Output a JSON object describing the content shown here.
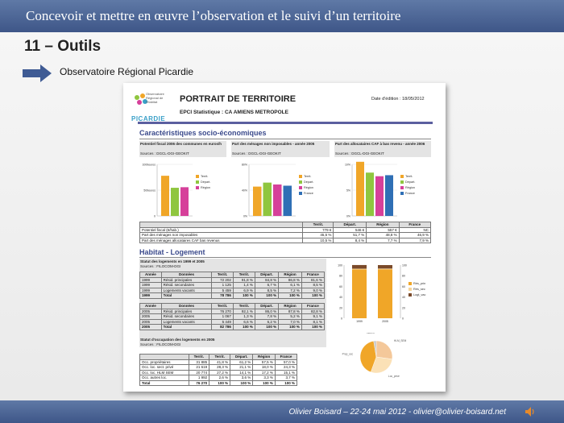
{
  "header": {
    "title": "Concevoir et mettre en œuvre l’observation et le suivi d’un territoire"
  },
  "section": {
    "title": "11 – Outils",
    "subtitle": "Observatoire Régional Picardie"
  },
  "footer": {
    "text": "Olivier Boisard – 22-24 mai 2012 - olivier@olivier-boisard.net"
  },
  "document": {
    "logo_word": "PICARDIE",
    "logo_sub": "Observatoire Régional de l'Habitat",
    "title": "PORTRAIT DE TERRITOIRE",
    "subtitle": "EPCI Statistique : CA AMIENS METROPOLE",
    "date": "Date d'édition : 18/05/2012",
    "socio": {
      "heading": "Caractéristiques socio-économiques",
      "blocks": [
        {
          "title": "Potentiel fiscal 2006 des communes en euros/h",
          "source": "Sources : DGCL-DGI-GEOKIT"
        },
        {
          "title": "Part des ménages non imposables - année 2005",
          "source": "Sources : DGCL-DGI-GEOKIT"
        },
        {
          "title": "Part des allocataires CAF à bas revenu - année 2006",
          "source": "Sources : DGCL-DGI-GEOKIT"
        }
      ],
      "table": {
        "headers": [
          "",
          "Territ.",
          "Départ.",
          "Région",
          "France"
        ],
        "rows": [
          [
            "Potentiel fiscal (€/hab.)",
            "779 €",
            "546 €",
            "557 €",
            "NC"
          ],
          [
            "Part des ménages non imposables",
            "45,5 %",
            "51,7 %",
            "48,8 %",
            "46,9 %"
          ],
          [
            "Part des ménages allocataires CAF bas revenus",
            "10,5 %",
            "8,4 %",
            "7,7 %",
            "7,9 %"
          ]
        ]
      }
    },
    "habitat": {
      "heading": "Habitat - Logement",
      "block_title": "Statut des logements en 1999 et 2005",
      "source": "Sources : FILOCOM-DGI",
      "headers": [
        "Année",
        "Données",
        "Territ.",
        "Territ.",
        "Départ.",
        "Région",
        "France"
      ],
      "rows_1999": [
        [
          "1999",
          "Résid. principales",
          "72 202",
          "91,8 %",
          "84,8 %",
          "86,8 %",
          "81,6 %"
        ],
        [
          "1999",
          "Résid. secondaires",
          "1 125",
          "1,4 %",
          "6,7 %",
          "6,1 %",
          "8,5 %"
        ],
        [
          "1999",
          "Logements vacants",
          "5 459",
          "6,9 %",
          "8,5 %",
          "7,2 %",
          "9,0 %"
        ],
        [
          "1999",
          "Total",
          "78 786",
          "100 %",
          "100 %",
          "100 %",
          "100 %"
        ]
      ],
      "rows_2005": [
        [
          "2005",
          "Résid. principales",
          "76 270",
          "92,1 %",
          "86,0 %",
          "87,8 %",
          "82,8 %"
        ],
        [
          "2005",
          "Résid. secondaires",
          "1 067",
          "1,3 %",
          "7,8 %",
          "5,2 %",
          "9,1 %"
        ],
        [
          "2005",
          "Logements vacants",
          "5 449",
          "6,6 %",
          "6,2 %",
          "7,0 %",
          "8,1 %"
        ],
        [
          "2005",
          "Total",
          "82 786",
          "100 %",
          "100 %",
          "100 %",
          "100 %"
        ]
      ],
      "occupation_title": "Statut d'occupation des logements en 2005",
      "occupation_source": "Sources : FILOCOM-DGI",
      "occupation_headers": [
        "",
        "Territ.",
        "Territ.",
        "Départ.",
        "Région",
        "France"
      ],
      "occupation_rows": [
        [
          "Occ. propriétaires",
          "31 885",
          "41,8 %",
          "61,2 %",
          "57,5 %",
          "57,0 %"
        ],
        [
          "Occ. loc. sect. privé",
          "21 619",
          "28,3 %",
          "21,1 %",
          "18,0 %",
          "24,3 %"
        ],
        [
          "Occ. loc. HLM SEM",
          "20 774",
          "27,2 %",
          "14,1 %",
          "17,2 %",
          "15,1 %"
        ],
        [
          "Occ. autres loc.",
          "1 992",
          "2,6 %",
          "3,6 %",
          "3,3 %",
          "3,7 %"
        ],
        [
          "Total",
          "76 270",
          "100 %",
          "100 %",
          "100 %",
          "100 %"
        ]
      ],
      "stack_legend": [
        "Rés_prin",
        "Rés_sec",
        "Logt_vac"
      ],
      "stack_years": [
        "1999",
        "2005"
      ],
      "pie_labels": [
        "HLM_SEM",
        "Loc_privé",
        "Prop_occ",
        "Autres"
      ]
    },
    "colors": {
      "territ": "#f0a628",
      "depart": "#8fc63f",
      "region": "#d6409a",
      "france": "#2f6fb5",
      "stack_main": "#f0a628",
      "stack_sec": "#f5d49a",
      "stack_vac": "#7a4a2a",
      "heading": "#3b4a8c"
    },
    "chart_data": [
      {
        "type": "bar",
        "categories": [
          "Territ.",
          "Départ.",
          "Région"
        ],
        "values": [
          779,
          546,
          557
        ],
        "ylim": [
          0,
          1000
        ],
        "ytick_labels": [
          "0",
          "500euros",
          "1000euros"
        ]
      },
      {
        "type": "bar",
        "categories": [
          "Territ.",
          "Départ.",
          "Région",
          "France"
        ],
        "values": [
          45.5,
          51.7,
          48.8,
          46.9
        ],
        "ylim": [
          0,
          80
        ],
        "ytick_labels": [
          "0%",
          "40%",
          "80%"
        ]
      },
      {
        "type": "bar",
        "categories": [
          "Territ.",
          "Départ.",
          "Région",
          "France"
        ],
        "values": [
          10.5,
          8.4,
          7.7,
          7.9
        ],
        "ylim": [
          0,
          10
        ],
        "ytick_labels": [
          "0%",
          "5%",
          "10%"
        ]
      }
    ]
  }
}
